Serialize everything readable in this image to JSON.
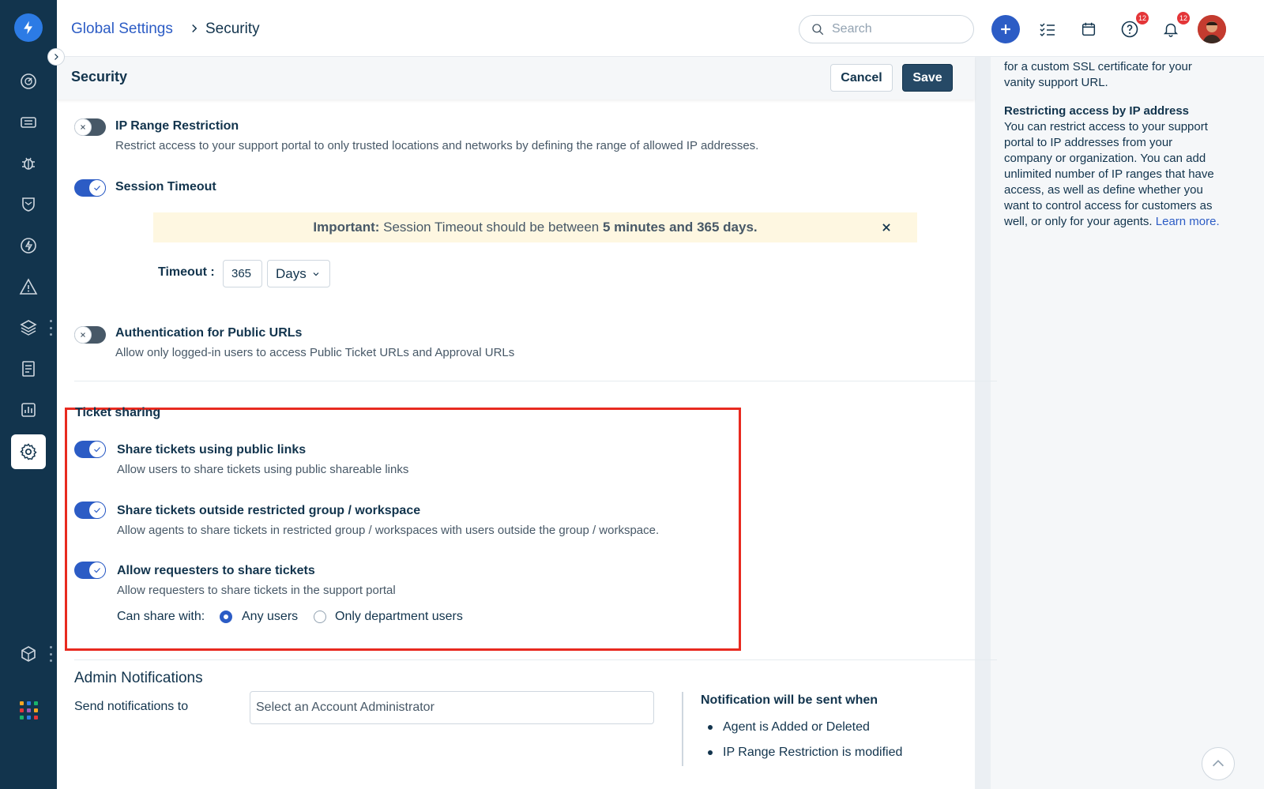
{
  "breadcrumb": {
    "parent": "Global Settings",
    "current": "Security"
  },
  "search": {
    "placeholder": "Search"
  },
  "topbar": {
    "help_badge": "12",
    "notifications_badge": "12"
  },
  "subheader": {
    "title": "Security",
    "cancel_label": "Cancel",
    "save_label": "Save"
  },
  "settings": {
    "ip_range": {
      "title": "IP Range Restriction",
      "desc": "Restrict access to your support portal to only trusted locations and networks by defining the range of allowed IP addresses.",
      "enabled": false
    },
    "session_timeout": {
      "title": "Session Timeout",
      "enabled": true,
      "alert_prefix": "Important:",
      "alert_text": "Session Timeout should be between",
      "alert_min": "5 minutes",
      "alert_and": "and",
      "alert_max": "365 days.",
      "timeout_label": "Timeout :",
      "timeout_value": "365",
      "unit": "Days"
    },
    "auth_public": {
      "title": "Authentication for Public URLs",
      "desc": "Allow only logged-in users to access Public Ticket URLs and Approval URLs",
      "enabled": false
    }
  },
  "ticket_sharing": {
    "heading": "Ticket sharing",
    "items": [
      {
        "title": "Share tickets using public links",
        "desc": "Allow users to share tickets using public shareable links",
        "enabled": true
      },
      {
        "title": "Share tickets outside restricted group / workspace",
        "desc": "Allow agents to share tickets in restricted group / workspaces with users outside the group / workspace.",
        "enabled": true
      },
      {
        "title": "Allow requesters to share tickets",
        "desc": "Allow requesters to share tickets in the support portal",
        "enabled": true
      }
    ],
    "can_share_label": "Can share with:",
    "options": [
      "Any users",
      "Only department users"
    ],
    "selected_option": "Any users"
  },
  "admin_notifications": {
    "title": "Admin Notifications",
    "send_label": "Send notifications to",
    "select_placeholder": "Select an Account Administrator",
    "sent_when_title": "Notification will be sent when",
    "events": [
      "Agent is Added or Deleted",
      "IP Range Restriction is modified"
    ]
  },
  "right_panel": {
    "partial_line": "for a custom SSL certificate for your",
    "partial_line2": "vanity support URL.",
    "ip_heading": "Restricting access by IP address",
    "ip_lines": [
      "You can restrict access to your support",
      "portal to IP addresses from your",
      "company or organization. You can add",
      "unlimited number of IP ranges that have",
      "access, as well as define whether you",
      "want to control access for customers as"
    ],
    "ip_last": "well, or only for your agents.",
    "learn_more": "Learn more."
  },
  "colors": {
    "sidebar": "#12344d",
    "accent": "#2c5cc5",
    "highlight": "#e82a20",
    "alert_bg": "#fef7e1"
  }
}
